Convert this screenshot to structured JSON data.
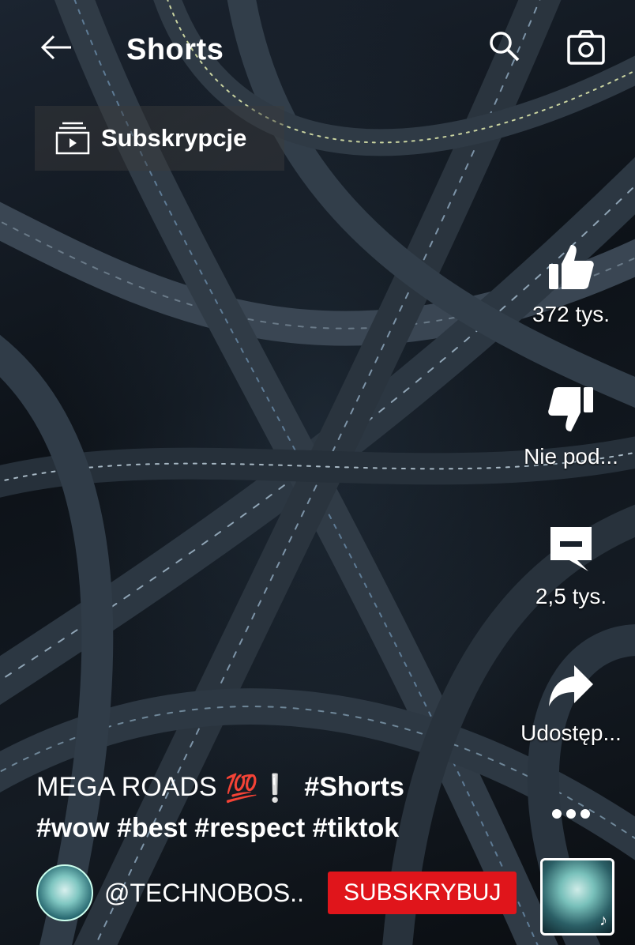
{
  "header": {
    "title": "Shorts"
  },
  "subscriptions_chip": {
    "label": "Subskrypcje"
  },
  "actions": {
    "like_count": "372 tys.",
    "dislike_label": "Nie pod...",
    "comments_count": "2,5 tys.",
    "share_label": "Udostęp..."
  },
  "caption": {
    "title": "MEGA ROADS",
    "emoji": "💯❕",
    "tag_shorts": "#Shorts",
    "tags": "#wow #best #respect #tiktok"
  },
  "channel": {
    "handle": "@TECHNOBOS..",
    "subscribe_label": "SUBSKRYBUJ"
  },
  "icons": {
    "back": "arrow-left-icon",
    "search": "search-icon",
    "camera": "camera-icon",
    "subscriptions": "subscriptions-icon",
    "like": "thumbs-up-icon",
    "dislike": "thumbs-down-icon",
    "comment": "comment-icon",
    "share": "share-icon",
    "more": "more-icon"
  },
  "colors": {
    "subscribe_button": "#e0151b",
    "text": "#ffffff"
  }
}
